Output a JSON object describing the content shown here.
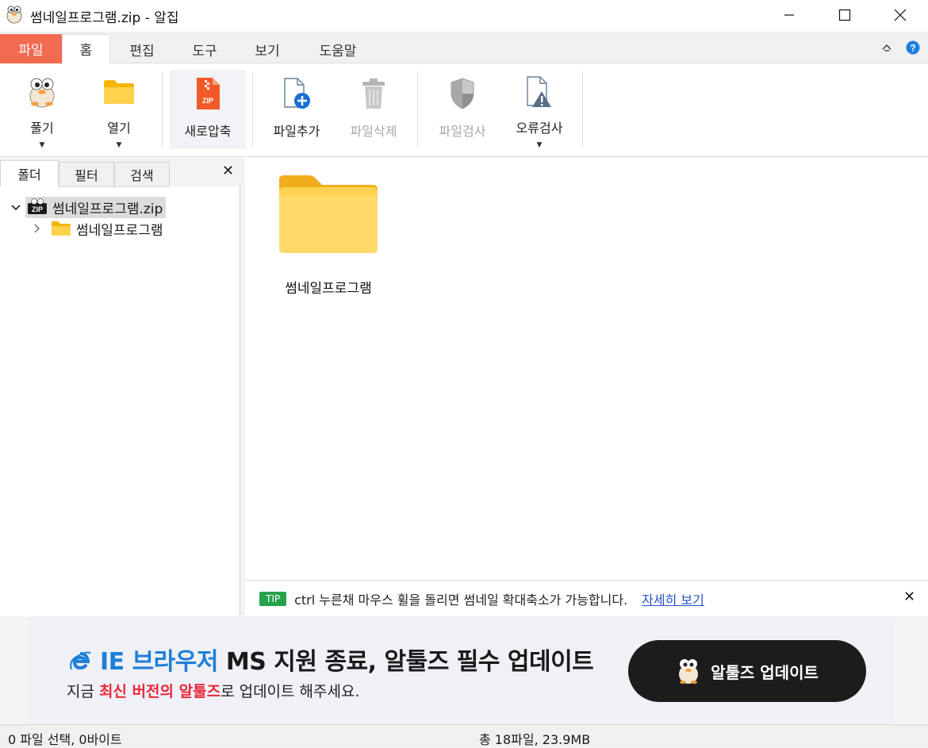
{
  "window": {
    "title": "썸네일프로그램.zip - 알집"
  },
  "tabs": [
    {
      "label": "파일"
    },
    {
      "label": "홈"
    },
    {
      "label": "편집"
    },
    {
      "label": "도구"
    },
    {
      "label": "보기"
    },
    {
      "label": "도움말"
    }
  ],
  "ribbon": {
    "extract": "풀기",
    "open": "열기",
    "new_compress": "새로압축",
    "add_file": "파일추가",
    "delete_file": "파일삭제",
    "scan_file": "파일검사",
    "error_check": "오류검사"
  },
  "left_panel": {
    "tabs": [
      "폴더",
      "필터",
      "검색"
    ],
    "tree_root": "썸네일프로그램.zip",
    "tree_child": "썸네일프로그램"
  },
  "main": {
    "folder_name": "썸네일프로그램"
  },
  "tip": {
    "badge": "TIP",
    "text": "ctrl 누른채 마우스 휠을 돌리면 썸네일 확대축소가 가능합니다.",
    "link": "자세히 보기"
  },
  "ad": {
    "line1_blue": "IE 브라우저",
    "line1_dark": "MS 지원 종료, 알툴즈 필수 업데이트",
    "line2_a": "지금 ",
    "line2_red": "최신 버전의 알툴즈",
    "line2_b": "로 업데이트 해주세요.",
    "button": "알툴즈 업데이트"
  },
  "status": {
    "left": "0 파일 선택,  0바이트",
    "right": "총 18파일,  23.9MB"
  },
  "colors": {
    "file_tab": "#f26a50",
    "tip_badge": "#25a24b",
    "link": "#2452c9",
    "ad_blue": "#1e7fd8",
    "ad_red": "#e8283c"
  }
}
